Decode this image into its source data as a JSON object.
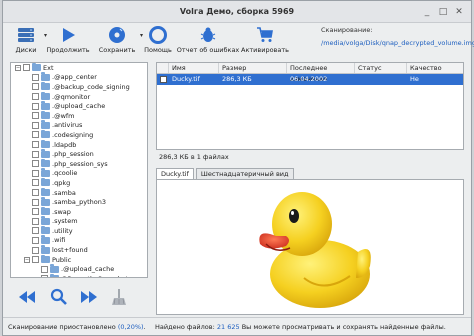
{
  "window": {
    "title": "Volга Демо, сборка 5969"
  },
  "toolbar": {
    "disks": "Диски",
    "continue": "Продолжить",
    "save": "Сохранить",
    "help": "Помощь",
    "report": "Отчет об ошибках",
    "activate": "Активировать"
  },
  "scan": {
    "label": "Сканирование:",
    "path": "/media/volga/Disk/qnap_decrypted_volume.img"
  },
  "tree": {
    "items": [
      {
        "label": "Ext",
        "level": 0,
        "expander": "−"
      },
      {
        "label": ".@app_center",
        "level": 1
      },
      {
        "label": ".@backup_code_signing",
        "level": 1
      },
      {
        "label": ".@qmonitor",
        "level": 1
      },
      {
        "label": ".@upload_cache",
        "level": 1
      },
      {
        "label": ".@wfm",
        "level": 1
      },
      {
        "label": ".antivirus",
        "level": 1
      },
      {
        "label": ".codesigning",
        "level": 1
      },
      {
        "label": ".ldapdb",
        "level": 1
      },
      {
        "label": ".php_session",
        "level": 1
      },
      {
        "label": ".php_session_sys",
        "level": 1
      },
      {
        "label": ".qcoolie",
        "level": 1
      },
      {
        "label": ".qpkg",
        "level": 1
      },
      {
        "label": ".samba",
        "level": 1
      },
      {
        "label": ".samba_python3",
        "level": 1
      },
      {
        "label": ".swap",
        "level": 1
      },
      {
        "label": ".system",
        "level": 1
      },
      {
        "label": ".utility",
        "level": 1
      },
      {
        "label": ".wifi",
        "level": 1
      },
      {
        "label": "lost+found",
        "level": 1
      },
      {
        "label": "Public",
        "level": 1,
        "expander": "−"
      },
      {
        "label": ".@upload_cache",
        "level": 2
      },
      {
        "label": "@Recently-Snapshot",
        "level": 2
      },
      {
        "label": "@Recycle",
        "level": 2
      },
      {
        "label": "Good Files",
        "level": 2,
        "expander": "+"
      },
      {
        "label": "[Unclassified]",
        "level": 1,
        "expander": "+"
      }
    ]
  },
  "table": {
    "columns": [
      "Имя",
      "Размер",
      "Последнее изменение",
      "Статус",
      "Качество"
    ],
    "rows": [
      {
        "name": "Ducky.tif",
        "size": "286,3 КБ",
        "modified": "06.04.2002 16:57:58",
        "status": "",
        "quality": "Не тестировано"
      }
    ]
  },
  "size_info": "286,3 КБ в 1 файлах",
  "preview": {
    "tabs": [
      "Ducky.tif",
      "Шестнадцатеричный вид"
    ]
  },
  "status": {
    "left_text": "Сканирование приостановлено",
    "left_pct": "(0,20%)",
    "left_end": ".",
    "found_label": "Найдено файлов:",
    "found_count": "21 625",
    "found_text": "Вы можете просматривать и сохранять найденные файлы."
  },
  "colors": {
    "selection": "#2f6fd0",
    "accent": "#1e5fbf",
    "duck": "#f5d020",
    "beak": "#e8452a"
  }
}
